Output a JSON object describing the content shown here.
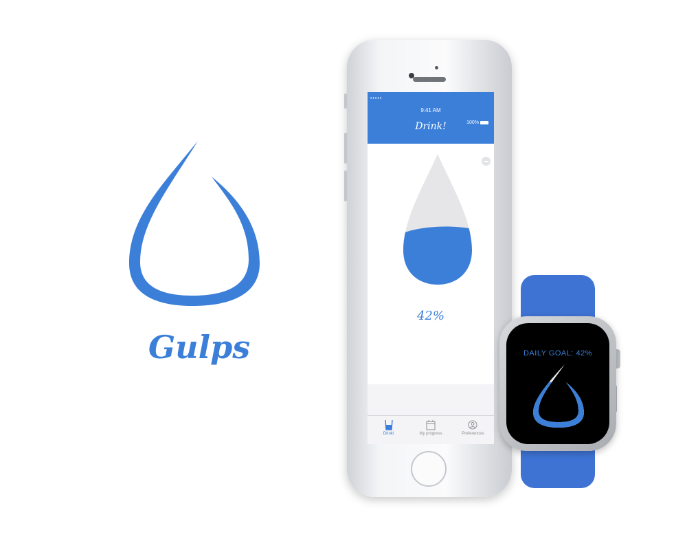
{
  "brand": {
    "name": "Gulps"
  },
  "phone": {
    "status": {
      "carrier": "•••••",
      "time": "9:41 AM",
      "battery": "100%"
    },
    "nav_title": "Drink!",
    "progress_percent_label": "42%",
    "progress_fraction": 0.42,
    "add_button_label": "+",
    "tabs": [
      {
        "label": "Drink!",
        "icon": "glass-icon",
        "active": true
      },
      {
        "label": "My progress",
        "icon": "calendar-icon",
        "active": false
      },
      {
        "label": "Preferences",
        "icon": "profile-icon",
        "active": false
      }
    ]
  },
  "watch": {
    "goal_label": "DAILY GOAL: 42%",
    "progress_fraction": 0.42
  },
  "colors": {
    "accent": "#3b7fd9",
    "drop_empty": "#e6e6e8",
    "band": "#3e73d4"
  }
}
